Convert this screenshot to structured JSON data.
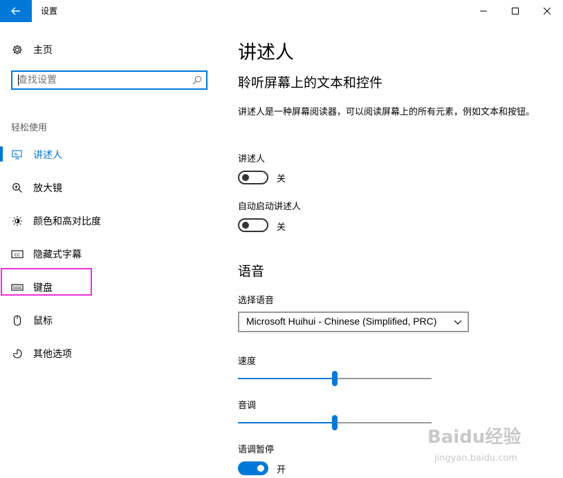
{
  "window": {
    "title": "设置",
    "colors": {
      "accent": "#0078d7",
      "highlight": "#ee2ed9"
    }
  },
  "sidebar": {
    "home_label": "主页",
    "search_placeholder": "查找设置",
    "section_title": "轻松使用",
    "items": [
      {
        "label": "讲述人",
        "icon": "narrator-icon",
        "active": true
      },
      {
        "label": "放大镜",
        "icon": "magnifier-icon"
      },
      {
        "label": "颜色和高对比度",
        "icon": "brightness-icon"
      },
      {
        "label": "隐藏式字幕",
        "icon": "closed-captions-icon"
      },
      {
        "label": "键盘",
        "icon": "keyboard-icon",
        "highlighted": true
      },
      {
        "label": "鼠标",
        "icon": "mouse-icon"
      },
      {
        "label": "其他选项",
        "icon": "other-options-icon"
      }
    ]
  },
  "main": {
    "title": "讲述人",
    "subtitle": "聆听屏幕上的文本和控件",
    "description": "讲述人是一种屏幕阅读器，可以阅读屏幕上的所有元素，例如文本和按钮。",
    "narrator_toggle": {
      "label": "讲述人",
      "state_text": "关",
      "on": false
    },
    "autostart_toggle": {
      "label": "自动启动讲述人",
      "state_text": "关",
      "on": false
    },
    "voice_section": "语音",
    "select_voice_label": "选择语音",
    "selected_voice": "Microsoft Huihui - Chinese (Simplified, PRC)",
    "speed": {
      "label": "速度",
      "value": 0.5
    },
    "pitch": {
      "label": "音调",
      "value": 0.5
    },
    "intonation_pause": {
      "label": "语调暂停",
      "state_text": "开",
      "on": true
    }
  },
  "watermark": {
    "logo": "Baidu经验",
    "url": "jingyan.baidu.com"
  }
}
